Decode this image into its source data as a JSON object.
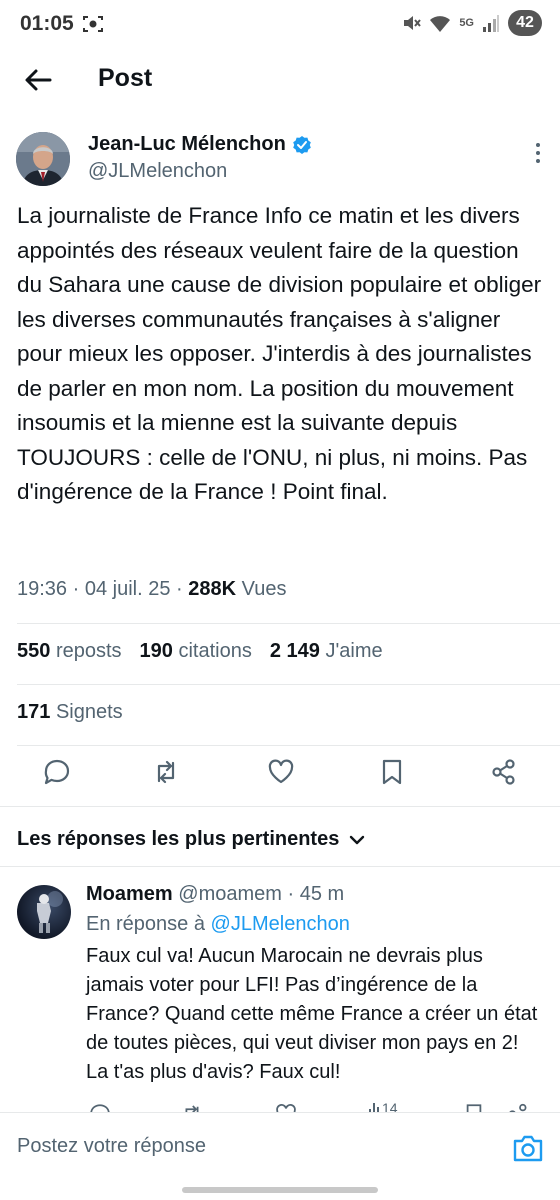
{
  "status_bar": {
    "time": "01:05",
    "network": "5G",
    "battery": "42"
  },
  "header": {
    "title": "Post"
  },
  "tweet": {
    "author_name": "Jean-Luc Mélenchon",
    "author_handle": "@JLMelenchon",
    "text": "La journaliste de France Info ce matin et les divers appointés des réseaux veulent faire de la question du Sahara une cause de division populaire et obliger les diverses communautés françaises à s'aligner pour mieux les opposer. J'interdis à des journalistes de parler en mon nom. La position du mouvement insoumis et la mienne est la suivante depuis TOUJOURS : celle de l'ONU, ni plus, ni moins. Pas d'ingérence de la France ! Point final.",
    "time": "19:36",
    "date": "04 juil. 25",
    "views_count": "288K",
    "views_label": "Vues",
    "reposts_count": "550",
    "reposts_label": "reposts",
    "quotes_count": "190",
    "quotes_label": "citations",
    "likes_count": "2 149",
    "likes_label": "J'aime",
    "bookmarks_count": "171",
    "bookmarks_label": "Signets"
  },
  "replies_sort": {
    "label": "Les réponses les plus pertinentes"
  },
  "reply": {
    "name": "Moamem",
    "handle": "@moamem",
    "age": "45 m",
    "reply_to_prefix": "En réponse à",
    "reply_to_handle": "@JLMelenchon",
    "text": "Faux cul va! Aucun Marocain ne devrais plus jamais voter pour LFI! Pas d’ingérence de la France? Quand cette même France a créer un état de toutes pièces, qui veut diviser mon pays en 2! La t'as plus d'avis? Faux cul!",
    "likes_count": "14"
  },
  "composer": {
    "placeholder": "Postez votre réponse"
  },
  "colors": {
    "accent": "#1d9bf0",
    "secondary_text": "#536471",
    "primary_text": "#0f1419"
  }
}
